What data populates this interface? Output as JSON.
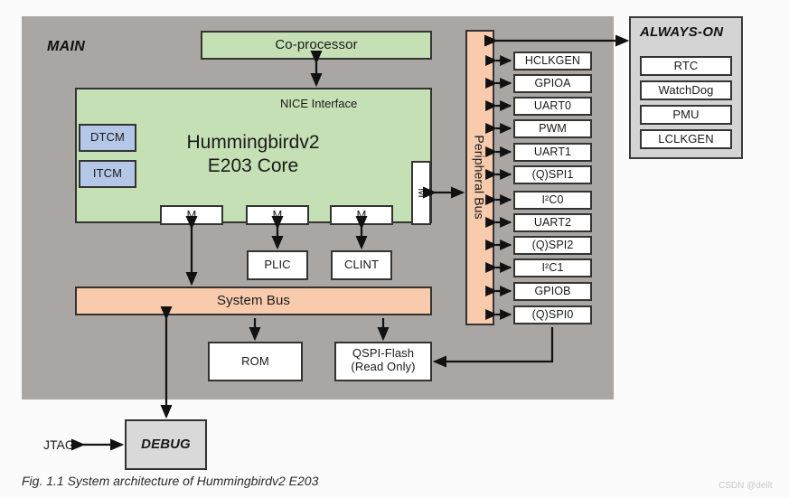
{
  "figure": {
    "caption": "Fig. 1.1 System architecture of Hummingbirdv2 E203",
    "watermark": "CSDN @deilt"
  },
  "colors": {
    "page_background": "#fbfbfb",
    "main_region": "#aaa6a4",
    "alwayson_region": "#d4d4d4",
    "core_green": "#c5e0b4",
    "bus_orange": "#f8cbad",
    "tcm_blue": "#b4c7e7",
    "debug_gray": "#d9d9d9",
    "box_white": "#ffffff",
    "stroke": "#333333"
  },
  "regions": {
    "main": {
      "label": "MAIN"
    },
    "always_on": {
      "label": "ALWAYS-ON"
    }
  },
  "blocks": {
    "coprocessor": "Co-processor",
    "nice_interface": "NICE Interface",
    "core_line1": "Hummingbirdv2",
    "core_line2": "E203 Core",
    "dtcm": "DTCM",
    "itcm": "ITCM",
    "master_port": "M",
    "plic": "PLIC",
    "clint": "CLINT",
    "system_bus": "System Bus",
    "peripheral_bus": "Peripheral Bus",
    "rom": "ROM",
    "qspi_flash_line1": "QSPI-Flash",
    "qspi_flash_line2": "(Read Only)",
    "debug": "DEBUG",
    "jtag": "JTAG"
  },
  "core_master_ports": [
    "M",
    "M",
    "M"
  ],
  "peripherals": [
    "HCLKGEN",
    "GPIOA",
    "UART0",
    "PWM",
    "UART1",
    "(Q)SPI1",
    "I²C0",
    "UART2",
    "(Q)SPI2",
    "I²C1",
    "GPIOB",
    "(Q)SPI0"
  ],
  "always_on_blocks": [
    "RTC",
    "WatchDog",
    "PMU",
    "LCLKGEN"
  ]
}
